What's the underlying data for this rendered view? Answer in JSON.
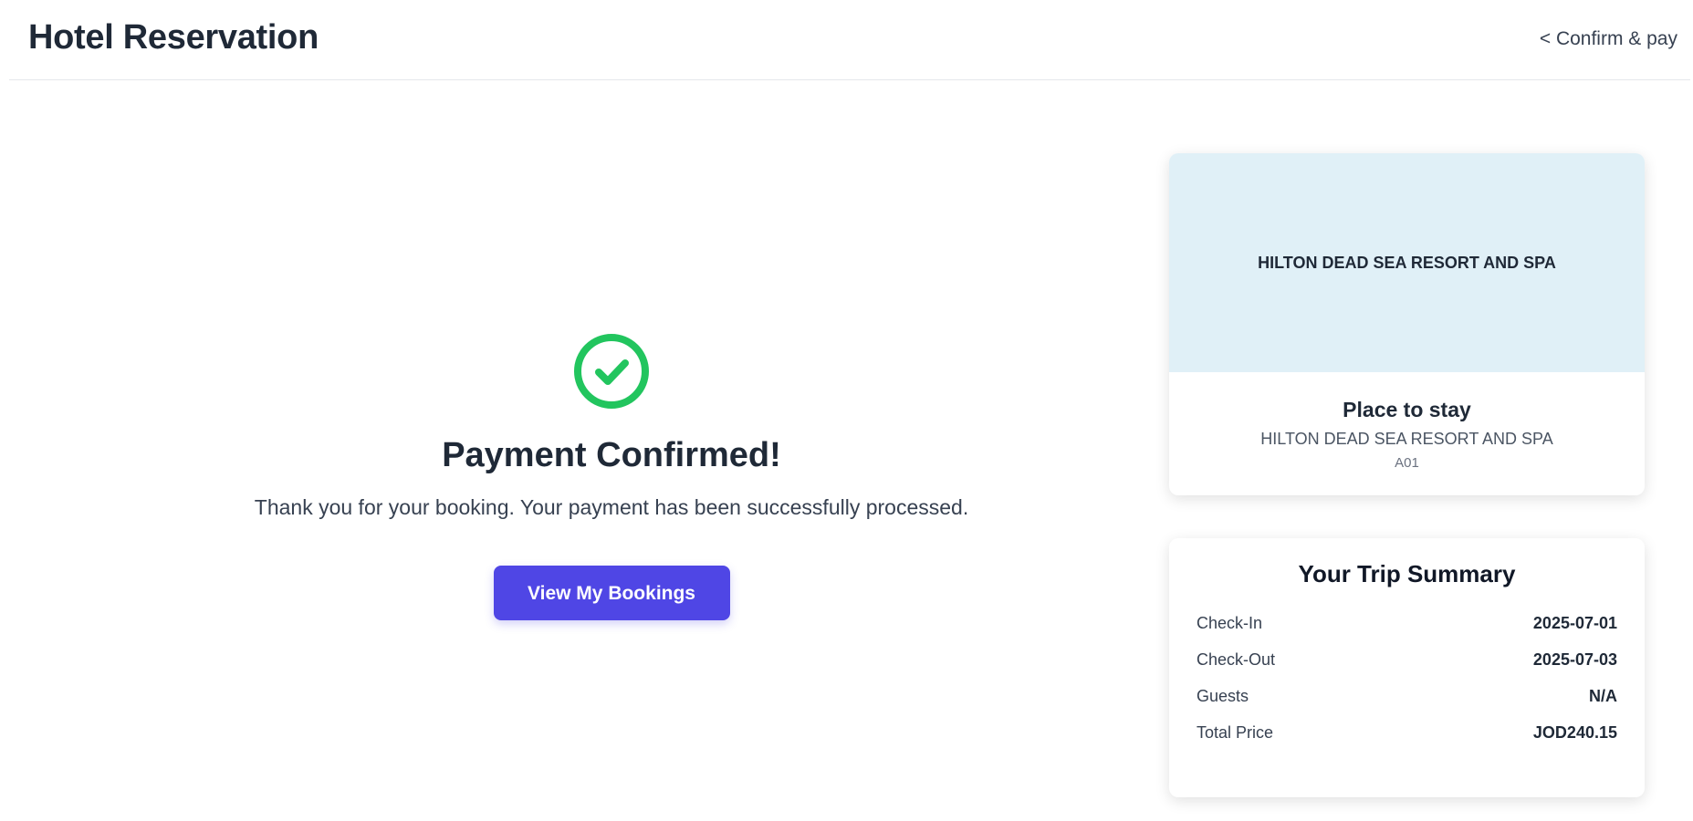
{
  "header": {
    "title": "Hotel Reservation",
    "back_link": "< Confirm & pay"
  },
  "confirmation": {
    "icon": "check-circle-icon",
    "title": "Payment Confirmed!",
    "message": "Thank you for your booking. Your payment has been successfully processed.",
    "button_label": "View My Bookings"
  },
  "hotel_card": {
    "banner_text": "HILTON DEAD SEA RESORT AND SPA",
    "heading": "Place to stay",
    "hotel_name": "HILTON DEAD SEA RESORT AND SPA",
    "room_code": "A01"
  },
  "trip_summary": {
    "title": "Your Trip Summary",
    "rows": [
      {
        "label": "Check-In",
        "value": "2025-07-01"
      },
      {
        "label": "Check-Out",
        "value": "2025-07-03"
      },
      {
        "label": "Guests",
        "value": "N/A"
      },
      {
        "label": "Total Price",
        "value": "JOD240.15"
      }
    ]
  },
  "colors": {
    "accent": "#4f46e5",
    "success": "#22c55e",
    "banner_bg": "#e0f0f7",
    "text_dark": "#1f2937"
  }
}
